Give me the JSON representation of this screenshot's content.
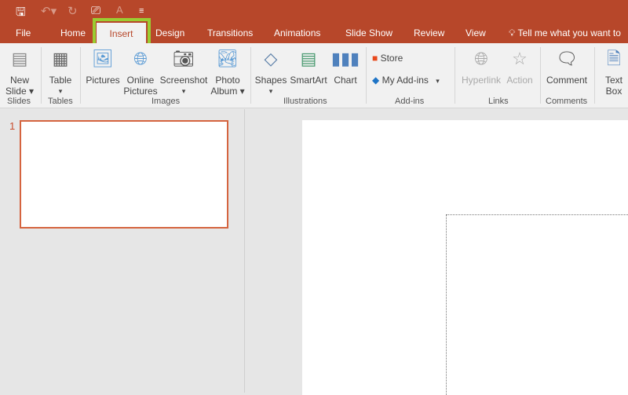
{
  "quick_access": {
    "save": "save-icon",
    "undo": "undo-icon",
    "redo": "redo-icon",
    "present": "present-icon",
    "font": "A",
    "customize": "customize-icon"
  },
  "tabs": [
    "File",
    "Home",
    "Insert",
    "Design",
    "Transitions",
    "Animations",
    "Slide Show",
    "Review",
    "View"
  ],
  "active_tab": "Insert",
  "tell_me": "Tell me what you want to",
  "ribbon": {
    "new_slide": [
      "New",
      "Slide ▾"
    ],
    "table": [
      "Table",
      "▾"
    ],
    "pictures": "Pictures",
    "online_pictures": [
      "Online",
      "Pictures"
    ],
    "screenshot": [
      "Screenshot",
      "▾"
    ],
    "photo_album": [
      "Photo",
      "Album ▾"
    ],
    "shapes": [
      "Shapes",
      "▾"
    ],
    "smartart": "SmartArt",
    "chart": "Chart",
    "store": "Store",
    "my_addins": "My Add-ins",
    "hyperlink": "Hyperlink",
    "action": "Action",
    "comment": "Comment",
    "text_box": [
      "Text",
      "Box"
    ],
    "groups": [
      "Slides",
      "Tables",
      "Images",
      "Illustrations",
      "Add-ins",
      "Links",
      "Comments"
    ]
  },
  "slides_pane": {
    "slide_number": "1"
  },
  "colors": {
    "accent": "#b7472a",
    "highlight": "#9acd32",
    "selected_border": "#d5643f"
  }
}
